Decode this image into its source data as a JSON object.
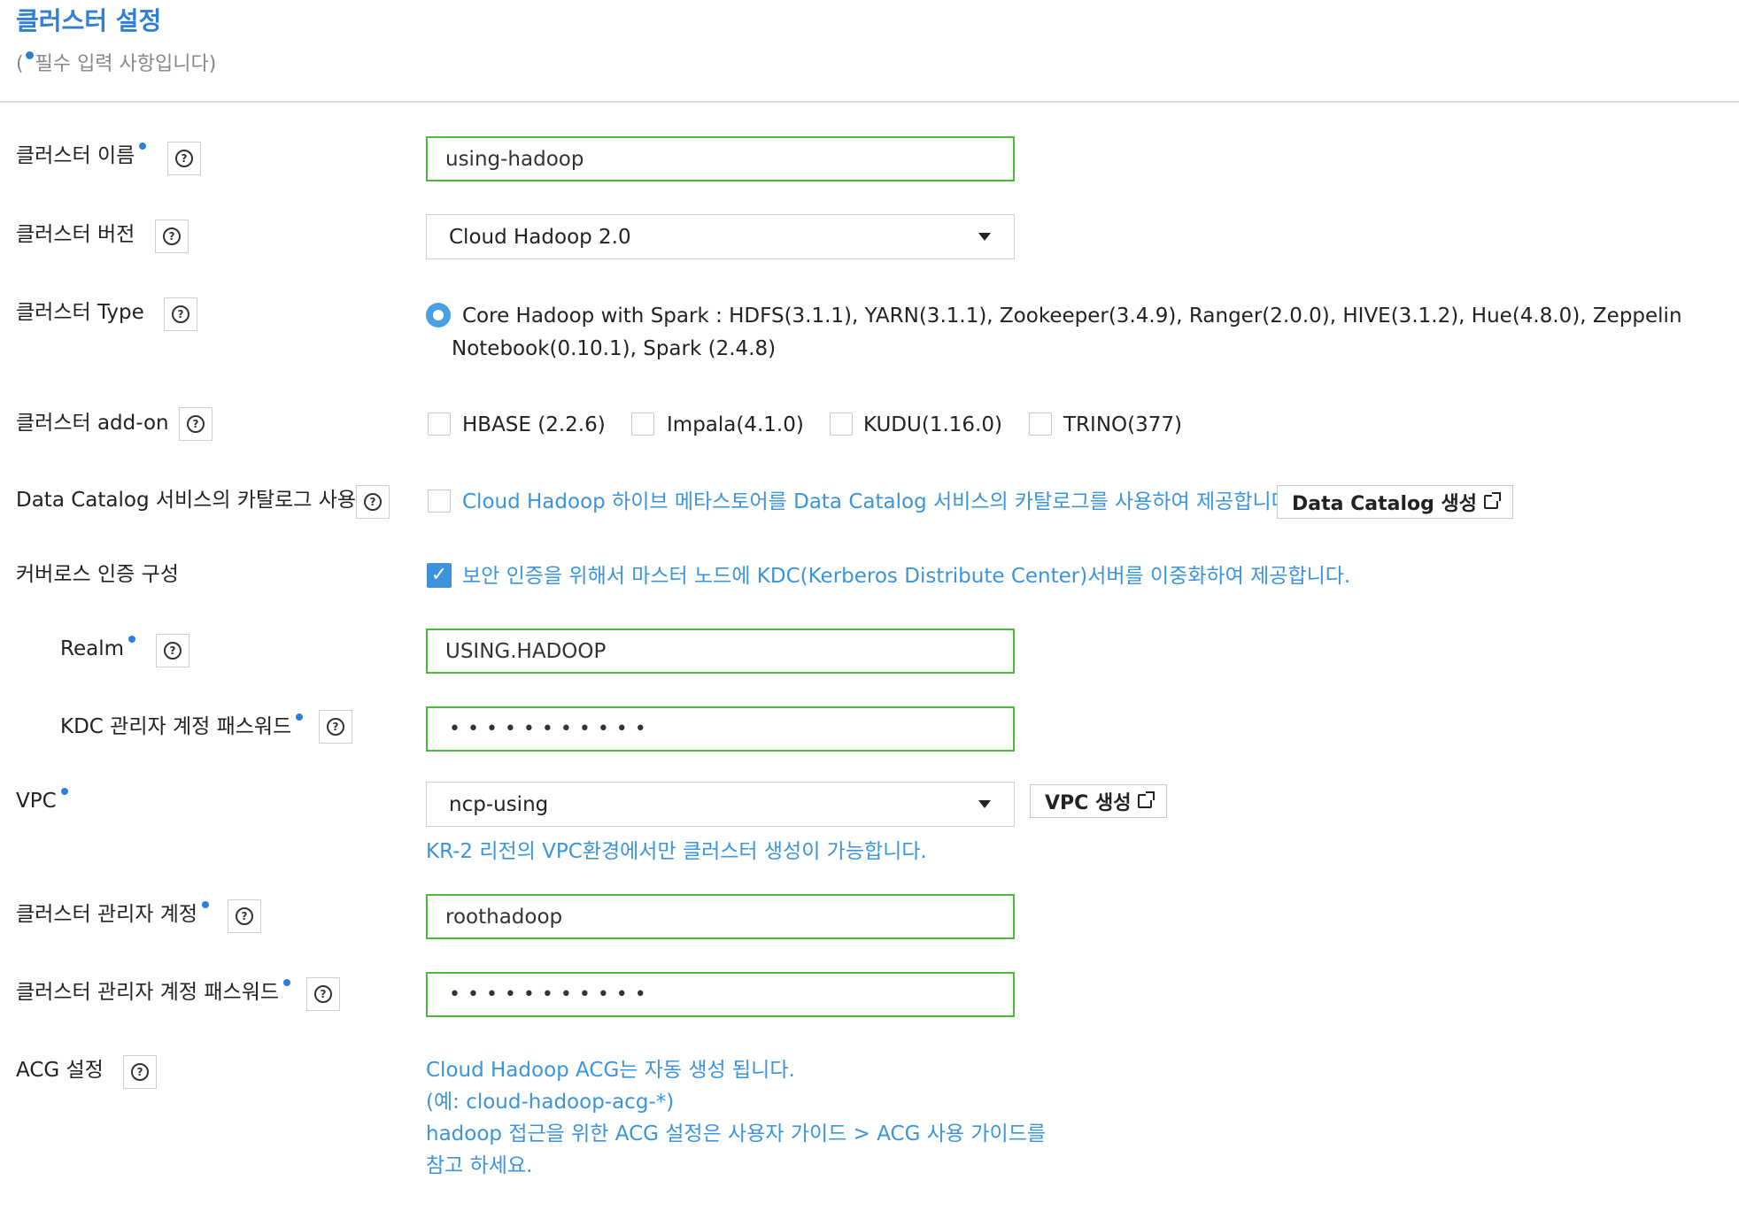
{
  "header": {
    "title": "클러스터 설정",
    "subtitle_open": "(",
    "subtitle_text": "필수 입력 사항입니다)"
  },
  "fields": {
    "cluster_name": {
      "label": "클러스터 이름",
      "value": "using-hadoop"
    },
    "cluster_version": {
      "label": "클러스터 버전",
      "selected": "Cloud Hadoop 2.0"
    },
    "cluster_type": {
      "label": "클러스터 Type",
      "option_line1": "Core Hadoop with Spark : HDFS(3.1.1), YARN(3.1.1), Zookeeper(3.4.9), Ranger(2.0.0), HIVE(3.1.2), Hue(4.8.0), Zeppelin",
      "option_line2": "Notebook(0.10.1), Spark (2.4.8)"
    },
    "cluster_addon": {
      "label": "클러스터 add-on",
      "options": [
        "HBASE (2.2.6)",
        "Impala(4.1.0)",
        "KUDU(1.16.0)",
        "TRINO(377)"
      ]
    },
    "data_catalog": {
      "label": "Data Catalog 서비스의 카탈로그 사용",
      "description": "Cloud Hadoop 하이브 메타스토어를 Data Catalog 서비스의 카탈로그를 사용하여 제공합니다.",
      "button": "Data Catalog 생성"
    },
    "kerberos": {
      "label": "커버로스 인증 구성",
      "description": "보안 인증을 위해서 마스터 노드에 KDC(Kerberos Distribute Center)서버를 이중화하여 제공합니다."
    },
    "realm": {
      "label": "Realm",
      "value": "USING.HADOOP"
    },
    "kdc_password": {
      "label": "KDC 관리자 계정 패스워드",
      "value": "•••••••••••"
    },
    "vpc": {
      "label": "VPC",
      "selected": "ncp-using",
      "button": "VPC 생성",
      "note": "KR-2 리전의 VPC환경에서만 클러스터 생성이 가능합니다."
    },
    "admin_account": {
      "label": "클러스터 관리자 계정",
      "value": "roothadoop"
    },
    "admin_password": {
      "label": "클러스터 관리자 계정 패스워드",
      "value": "•••••••••••"
    },
    "acg": {
      "label": "ACG 설정",
      "lines": [
        "Cloud Hadoop ACG는 자동 생성 됩니다.",
        "(예: cloud-hadoop-acg-*)",
        "hadoop 접근을 위한 ACG 설정은 사용자 가이드 > ACG 사용 가이드를",
        "참고 하세요."
      ]
    }
  },
  "help_icon_glyph": "?",
  "check_glyph": "✓",
  "colors": {
    "accent": "#2f7fd8",
    "link": "#3b94dc",
    "valid_border": "#4cbb3c",
    "checkbox": "#3c93dc"
  }
}
